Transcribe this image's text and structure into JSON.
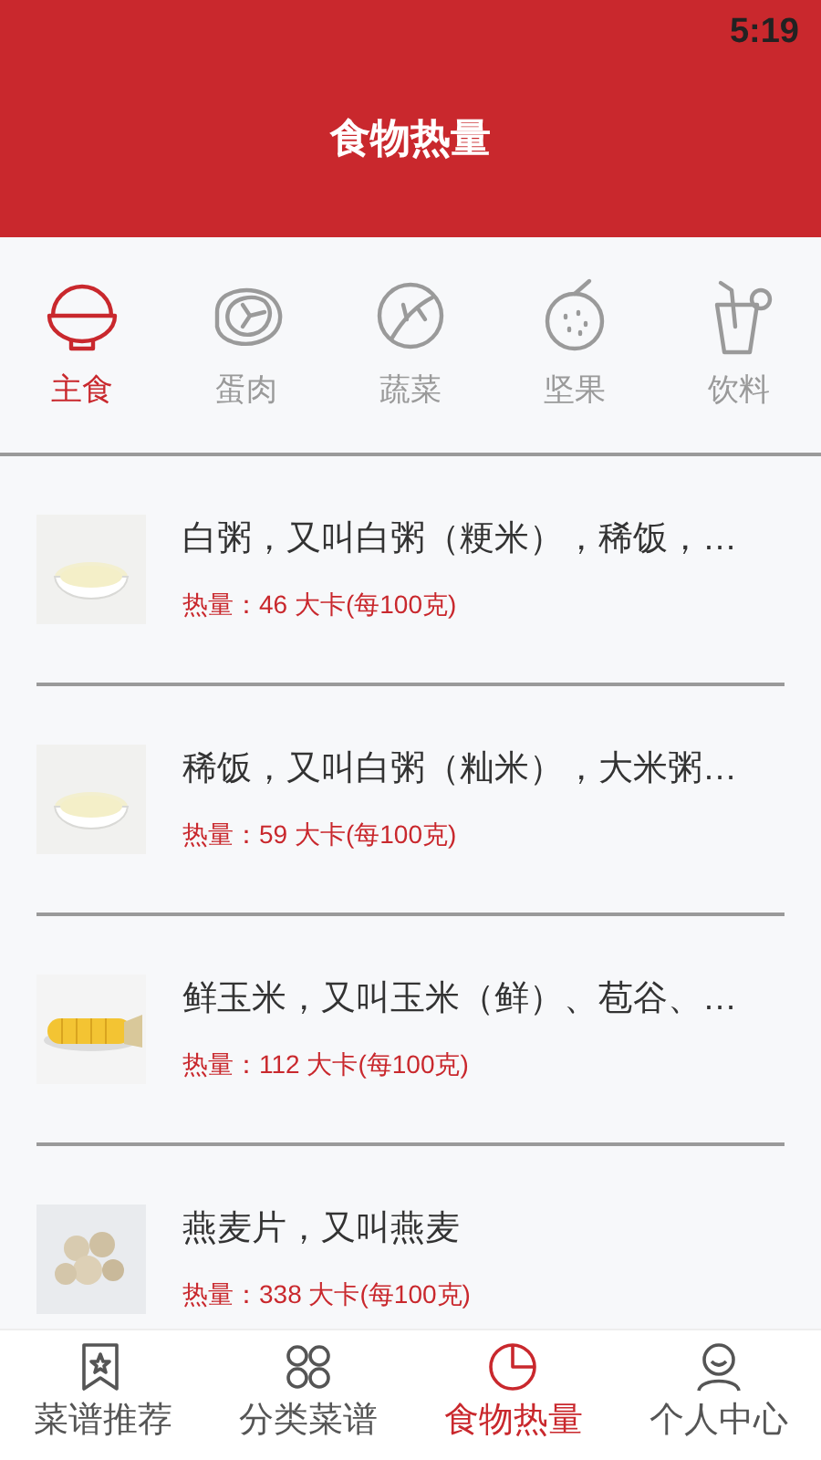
{
  "status_bar": {
    "time": "5:19"
  },
  "header": {
    "title": "食物热量"
  },
  "categories": [
    {
      "label": "主食",
      "selected": true,
      "kind": "bowl"
    },
    {
      "label": "蛋肉",
      "selected": false,
      "kind": "meat"
    },
    {
      "label": "蔬菜",
      "selected": false,
      "kind": "cabbage"
    },
    {
      "label": "坚果",
      "selected": false,
      "kind": "fruit"
    },
    {
      "label": "饮料",
      "selected": false,
      "kind": "drink"
    }
  ],
  "foods": [
    {
      "name": "白粥，又叫白粥（粳米），稀饭，…",
      "calories": "热量：46 大卡(每100克)",
      "kind": "porridge"
    },
    {
      "name": "稀饭，又叫白粥（籼米），大米粥…",
      "calories": "热量：59 大卡(每100克)",
      "kind": "porridge"
    },
    {
      "name": "鲜玉米，又叫玉米（鲜）、苞谷、…",
      "calories": "热量：112 大卡(每100克)",
      "kind": "corn"
    },
    {
      "name": "燕麦片，又叫燕麦",
      "calories": "热量：338 大卡(每100克)",
      "kind": "oats"
    }
  ],
  "bottom_nav": [
    {
      "label": "菜谱推荐",
      "selected": false,
      "kind": "bookmark"
    },
    {
      "label": "分类菜谱",
      "selected": false,
      "kind": "grid"
    },
    {
      "label": "食物热量",
      "selected": true,
      "kind": "pie"
    },
    {
      "label": "个人中心",
      "selected": false,
      "kind": "person"
    }
  ]
}
